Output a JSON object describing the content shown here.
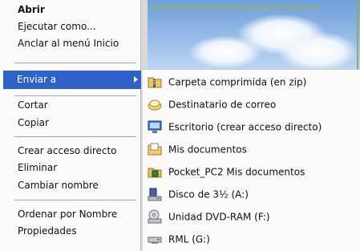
{
  "context_menu": {
    "items": [
      {
        "label": "Abrir"
      },
      {
        "label": "Ejecutar como..."
      },
      {
        "label": "Anclar al menú Inicio"
      },
      {
        "label": "Enviar a"
      },
      {
        "label": "Cortar"
      },
      {
        "label": "Copiar"
      },
      {
        "label": "Crear acceso directo"
      },
      {
        "label": "Eliminar"
      },
      {
        "label": "Cambiar nombre"
      },
      {
        "label": "Ordenar por Nombre"
      },
      {
        "label": "Propiedades"
      }
    ]
  },
  "send_to_submenu": {
    "items": [
      {
        "label": "Carpeta comprimida (en zip)",
        "icon": "zip-folder-icon"
      },
      {
        "label": "Destinatario de correo",
        "icon": "mail-recipient-icon"
      },
      {
        "label": "Escritorio (crear acceso directo)",
        "icon": "desktop-shortcut-icon"
      },
      {
        "label": "Mis documentos",
        "icon": "my-documents-icon"
      },
      {
        "label": "Pocket_PC2 Mis documentos",
        "icon": "pocket-pc-icon"
      },
      {
        "label": "Disco de 3½ (A:)",
        "icon": "floppy-disk-icon"
      },
      {
        "label": "Unidad DVD-RAM (F:)",
        "icon": "dvd-drive-icon"
      },
      {
        "label": "RML (G:)",
        "icon": "network-drive-icon"
      }
    ]
  },
  "colors": {
    "highlight": "#2f62c8",
    "menu_background": "#fbfbfb",
    "frame_green": "#8db05a"
  }
}
